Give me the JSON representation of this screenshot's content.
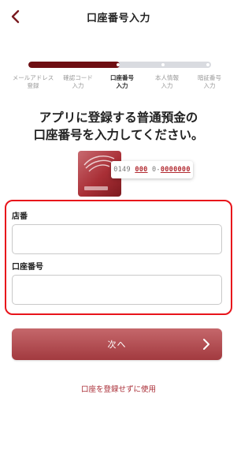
{
  "header": {
    "title": "口座番号入力",
    "back_icon": "chevron-left-icon"
  },
  "progress": {
    "fraction": 0.5,
    "fill_color": "#6e0e12",
    "track_color": "#d9dbe0"
  },
  "steps": [
    {
      "line1": "メールアドレス",
      "line2": "登録",
      "active": false
    },
    {
      "line1": "確認コード",
      "line2": "入力",
      "active": false
    },
    {
      "line1": "口座番号",
      "line2": "入力",
      "active": true
    },
    {
      "line1": "本人情報",
      "line2": "入力",
      "active": false
    },
    {
      "line1": "暗証番号",
      "line2": "入力",
      "active": false
    }
  ],
  "heading": {
    "line1": "アプリに登録する普通預金の",
    "line2": "口座番号を入力してください。"
  },
  "card_example": {
    "prefix": "0149",
    "branch": "000",
    "separator": "0-",
    "account": "0000000"
  },
  "form": {
    "branch_label": "店番",
    "branch_value": "",
    "account_label": "口座番号",
    "account_value": "",
    "highlight_color": "#e8141b"
  },
  "next_button": {
    "label": "次へ",
    "icon": "chevron-right-icon"
  },
  "skip_link": "口座を登録せずに使用",
  "colors": {
    "accent": "#a82a33",
    "button": "#b4494e"
  }
}
